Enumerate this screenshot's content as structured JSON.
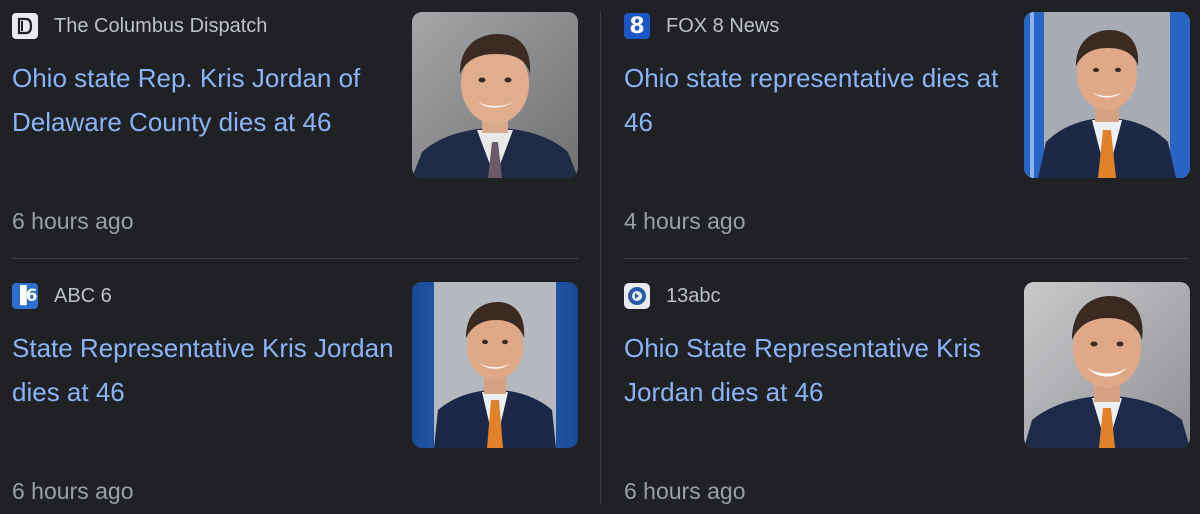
{
  "articles": [
    {
      "source": "The Columbus Dispatch",
      "logo_icon": "dispatch-logo-icon",
      "headline": "Ohio state Rep. Kris Jordan of Delaware County dies at 46",
      "time": "6 hours ago",
      "thumb_bg": "#8a8b8d"
    },
    {
      "source": "FOX 8 News",
      "logo_icon": "fox8-logo-icon",
      "logo_text": "8",
      "headline": "Ohio state representative dies at 46",
      "time": "4 hours ago",
      "thumb_bg": "#9ea4ad"
    },
    {
      "source": "ABC 6",
      "logo_icon": "abc6-logo-icon",
      "logo_text": "▐6",
      "headline": "State Representative Kris Jordan dies at 46",
      "time": "6 hours ago",
      "thumb_bg": "#1d4f9a"
    },
    {
      "source": "13abc",
      "logo_icon": "13abc-logo-icon",
      "headline": "Ohio State Representative Kris Jordan dies at 46",
      "time": "6 hours ago",
      "thumb_bg": "#a9abae"
    }
  ],
  "colors": {
    "background": "#202124",
    "headline": "#8ab4f8",
    "source_text": "#bdc1c6",
    "time_text": "#9aa0a6",
    "divider": "#3c4043"
  }
}
